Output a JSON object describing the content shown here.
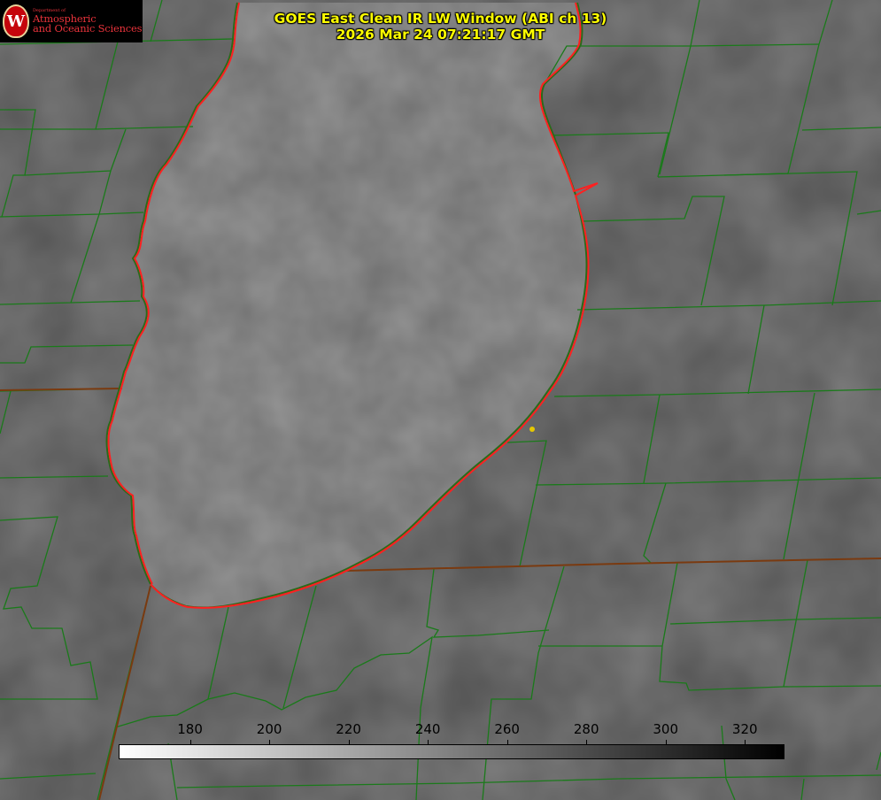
{
  "title": {
    "line1": "GOES East Clean IR LW Window (ABI ch 13)",
    "line2": "2026 Mar 24 07:21:17 GMT"
  },
  "logo": {
    "department": "Department of",
    "line1": "Atmospheric",
    "line2": "and Oceanic Sciences",
    "seal_letter": "W"
  },
  "colorbar": {
    "label_values": [
      "180",
      "200",
      "220",
      "240",
      "260",
      "280",
      "300",
      "320"
    ],
    "min": 162,
    "max": 330,
    "from_color": "#ffffff",
    "to_color": "#000000"
  },
  "colors": {
    "county_lines": "#1a7a1a",
    "coastline": "#ff2020",
    "marker": "#e6c800",
    "background": "#808080",
    "title_text": "#ffff00"
  },
  "legend_icon": "seal-icon"
}
